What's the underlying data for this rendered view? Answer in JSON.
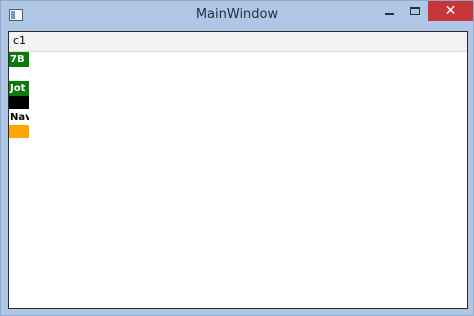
{
  "window": {
    "title": "MainWindow",
    "minimize_glyph": "",
    "close_glyph": "✕"
  },
  "grid": {
    "column_header": "c1",
    "rows": [
      {
        "label": "7B",
        "label_color": "#ffffff",
        "label_bg": "#0a7a0a",
        "swatch": null
      },
      {
        "label": "Jot",
        "label_color": "#ffffff",
        "label_bg": "#0a7a0a",
        "swatch": "#000000"
      },
      {
        "label": "Nav",
        "label_color": "#000000",
        "label_bg": "#ffffff",
        "swatch": "#ffa500"
      }
    ]
  }
}
